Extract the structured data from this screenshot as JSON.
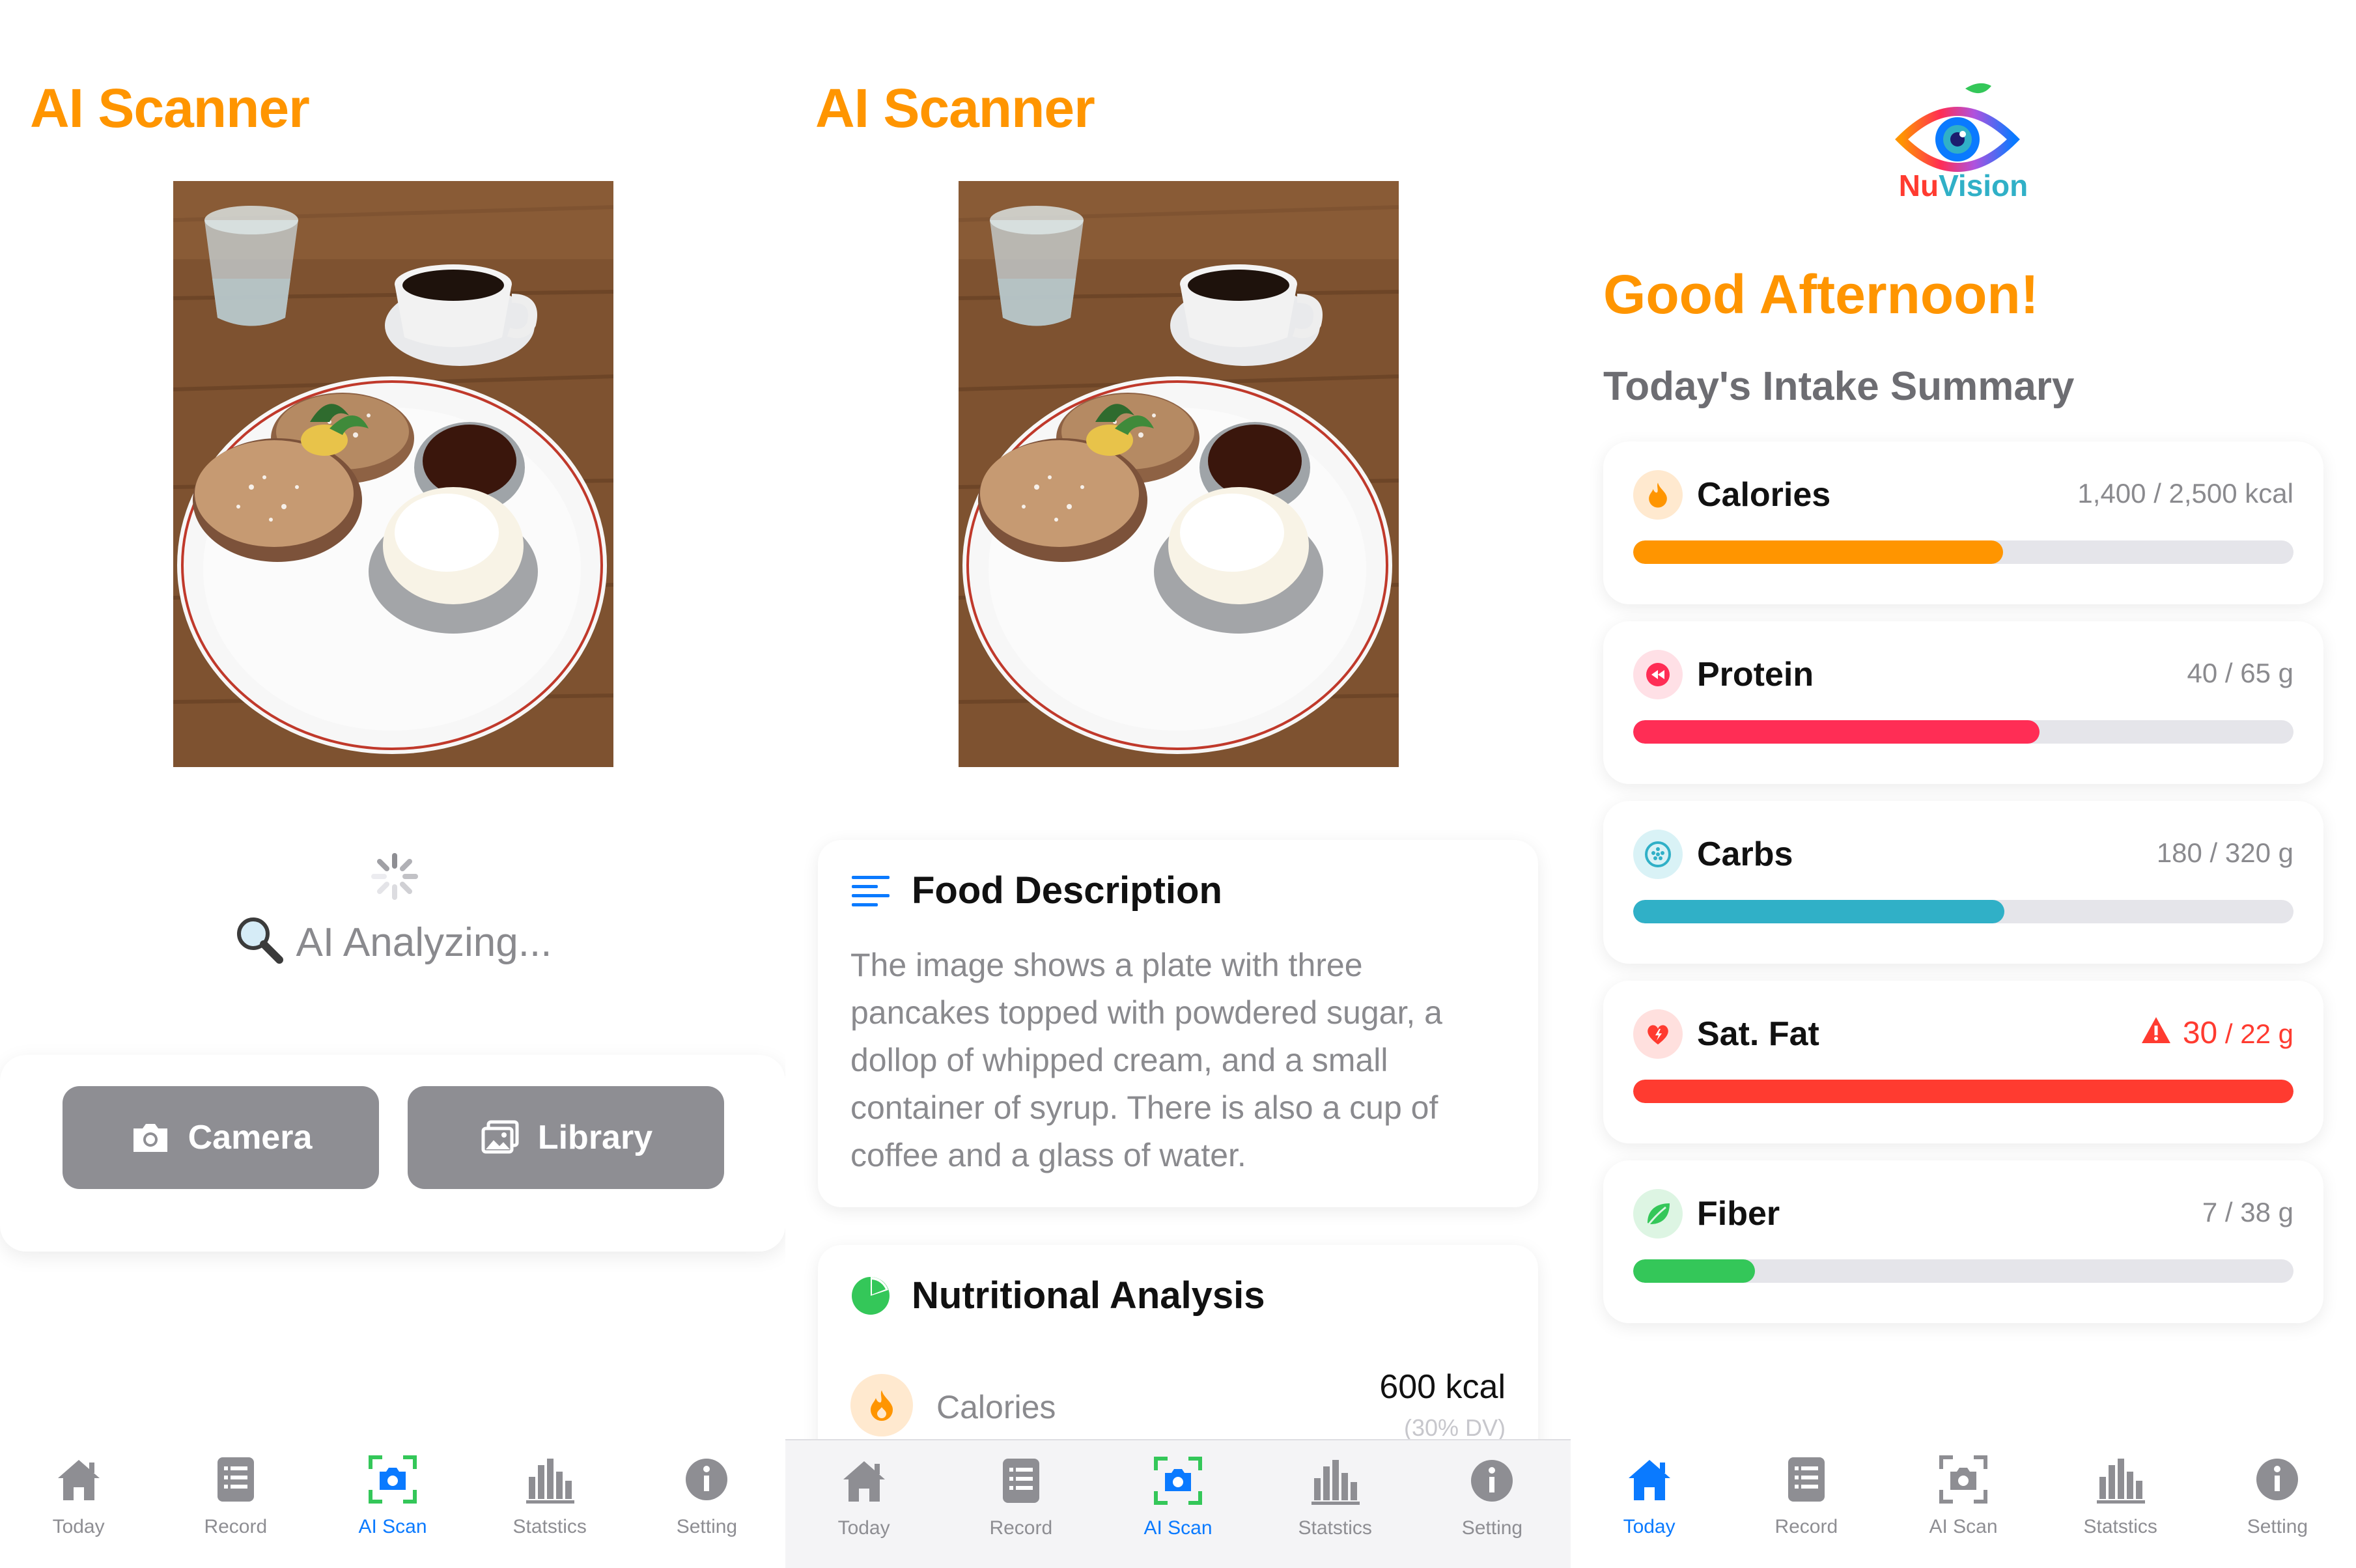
{
  "screens": [
    {
      "title": "AI Scanner",
      "status_text": "AI Analyzing...",
      "buttons": {
        "camera": "Camera",
        "library": "Library"
      },
      "tabs": [
        "Today",
        "Record",
        "AI Scan",
        "Statstics",
        "Setting"
      ],
      "active_tab": "AI Scan"
    },
    {
      "title": "AI Scanner",
      "food_description": {
        "heading": "Food Description",
        "text": "The image shows a plate with three pancakes topped with powdered sugar, a dollop of whipped cream, and a small container of syrup. There is also a cup of coffee and a glass of water."
      },
      "nutritional_analysis": {
        "heading": "Nutritional Analysis",
        "rows": [
          {
            "label": "Calories",
            "value": "600 kcal",
            "dv": "(30% DV)"
          }
        ]
      },
      "tabs": [
        "Today",
        "Record",
        "AI Scan",
        "Statstics",
        "Setting"
      ],
      "active_tab": "AI Scan"
    },
    {
      "logo": {
        "nu": "Nu",
        "vision": "Vision"
      },
      "greeting": "Good Afternoon!",
      "summary_title": "Today's Intake Summary",
      "intake": [
        {
          "name": "Calories",
          "value": "1,400 / 2,500 kcal",
          "current": 1400,
          "goal": 2500,
          "color": "#FF9500"
        },
        {
          "name": "Protein",
          "value": "40 / 65 g",
          "current": 40,
          "goal": 65,
          "color": "#FF2D55"
        },
        {
          "name": "Carbs",
          "value": "180 / 320 g",
          "current": 180,
          "goal": 320,
          "color": "#30B0C7"
        },
        {
          "name": "Sat. Fat",
          "current_text": "30",
          "goal_text": " / 22 g",
          "current": 30,
          "goal": 22,
          "color": "#FF3B30",
          "over_limit": true
        },
        {
          "name": "Fiber",
          "value": "7 / 38 g",
          "current": 7,
          "goal": 38,
          "color": "#34C759"
        }
      ],
      "tabs": [
        "Today",
        "Record",
        "AI Scan",
        "Statstics",
        "Setting"
      ],
      "active_tab": "Today"
    }
  ],
  "colors": {
    "accent": "#FF9500",
    "tab_active": "#0A7AFF",
    "tab_inactive": "#8e8e93",
    "button_gray": "#8e8e93"
  },
  "icons": {
    "tabs": [
      "house-icon",
      "clipboard-icon",
      "camera-scan-icon",
      "bar-chart-icon",
      "info-icon"
    ],
    "buttons": [
      "camera-icon",
      "photo-library-icon"
    ]
  }
}
